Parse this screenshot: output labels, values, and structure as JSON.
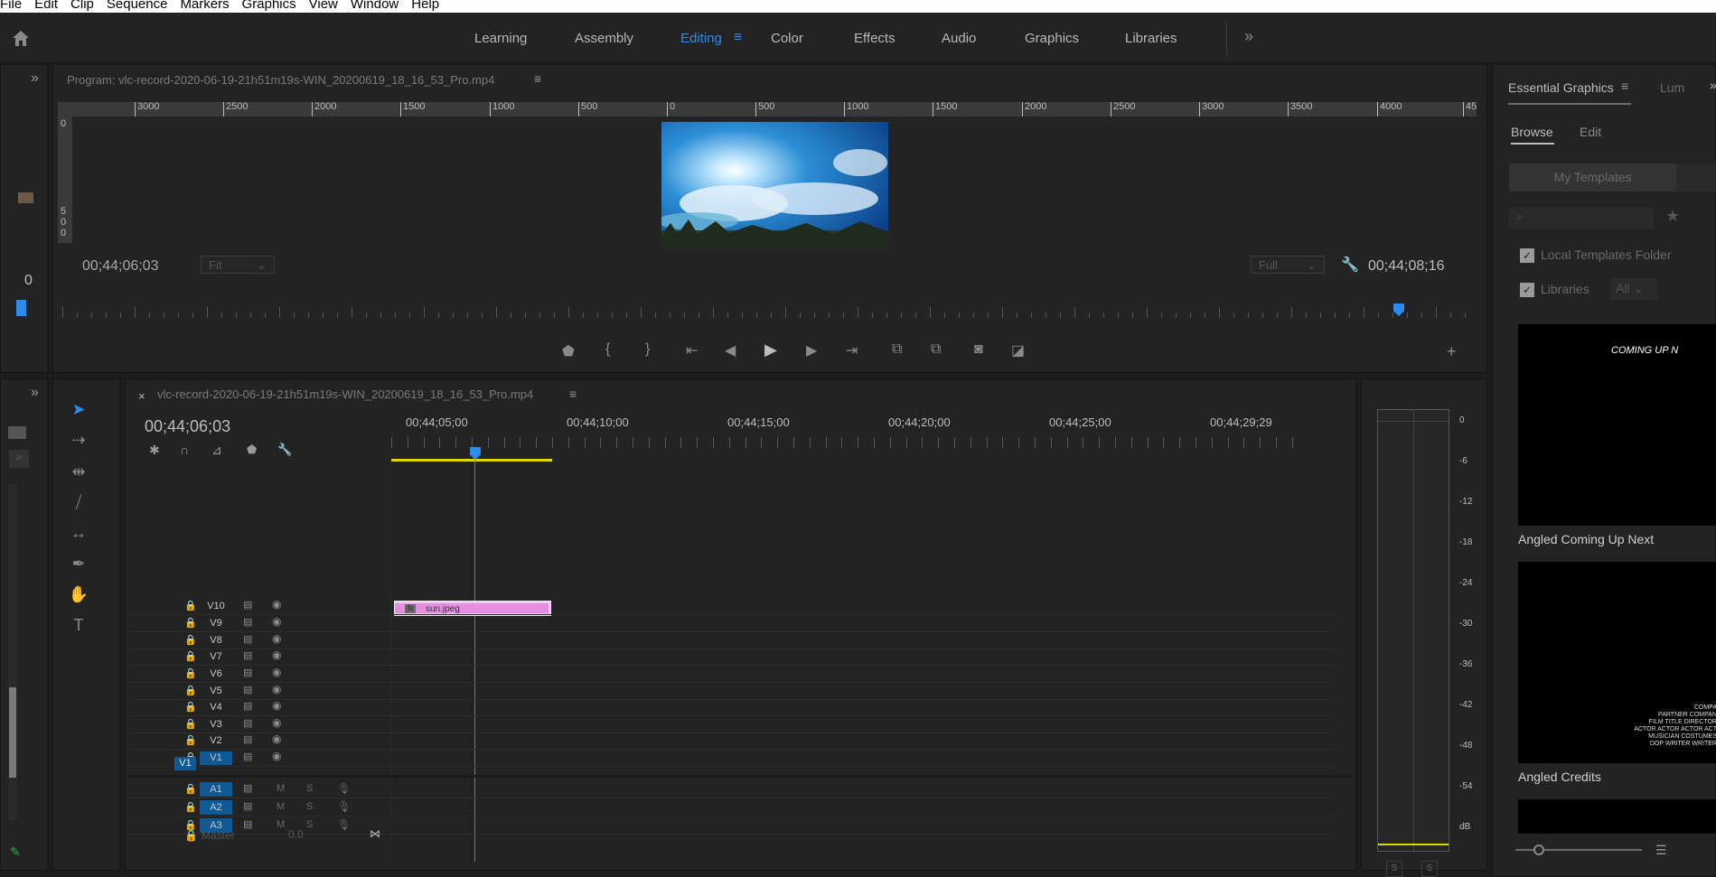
{
  "menu": [
    "File",
    "Edit",
    "Clip",
    "Sequence",
    "Markers",
    "Graphics",
    "View",
    "Window",
    "Help"
  ],
  "workspaces": {
    "learning": "Learning",
    "assembly": "Assembly",
    "editing": "Editing",
    "color": "Color",
    "effects": "Effects",
    "audio": "Audio",
    "graphics": "Graphics",
    "libraries": "Libraries"
  },
  "program": {
    "title": "Program: vlc-record-2020-06-19-21h51m19s-WIN_20200619_18_16_53_Pro.mp4",
    "timecode_in": "00;44;06;03",
    "fit": "Fit",
    "quality": "Full",
    "timecode_out": "00;44;08;16",
    "ruler": [
      "3000",
      "2500",
      "2000",
      "1500",
      "1000",
      "500",
      "0",
      "500",
      "1000",
      "1500",
      "2000",
      "2500",
      "3000",
      "3500",
      "4000",
      "45"
    ],
    "vruler": [
      "0",
      "5",
      "0",
      "0"
    ]
  },
  "left_panel": {
    "zero": "0"
  },
  "timeline": {
    "seq_title": "vlc-record-2020-06-19-21h51m19s-WIN_20200619_18_16_53_Pro.mp4",
    "timecode": "00;44;06;03",
    "ticks": [
      "00;44;05;00",
      "00;44;10;00",
      "00;44;15;00",
      "00;44;20;00",
      "00;44;25;00",
      "00;44;29;29"
    ],
    "video_tracks": [
      "V10",
      "V9",
      "V8",
      "V7",
      "V6",
      "V5",
      "V4",
      "V3",
      "V2",
      "V1"
    ],
    "source_v": "V1",
    "audio_tracks": [
      "A1",
      "A2",
      "A3"
    ],
    "m": "M",
    "s": "S",
    "master": "Master",
    "master_val": "0.0",
    "clip": {
      "fx": "fx",
      "name": "sun.jpeg"
    }
  },
  "meter": {
    "labels": [
      "0",
      "-6",
      "-12",
      "-18",
      "-24",
      "-30",
      "-36",
      "-42",
      "-48",
      "-54",
      "dB"
    ],
    "solo": "S"
  },
  "eg": {
    "title": "Essential Graphics",
    "tab2": "Lum",
    "browse": "Browse",
    "edit": "Edit",
    "my_templates": "My Templates",
    "local": "Local Templates Folder",
    "libraries": "Libraries",
    "all": "All",
    "thumb1_text": "COMING UP N",
    "item1": "Angled Coming Up Next",
    "item2": "Angled Credits",
    "credits": [
      "COMPA",
      "PARTNER COMPAN",
      "FILM TITLE  DIRECTOR",
      "ACTOR ACTOR ACTOR ACT",
      "MUSICIAN  COSTUMES",
      "DOP  WRITER WRITER"
    ]
  },
  "colors": {
    "accent": "#2d8ceb",
    "clip": "#e48fe3",
    "yellow": "#e6d500",
    "track_sel": "#0f5a95"
  }
}
